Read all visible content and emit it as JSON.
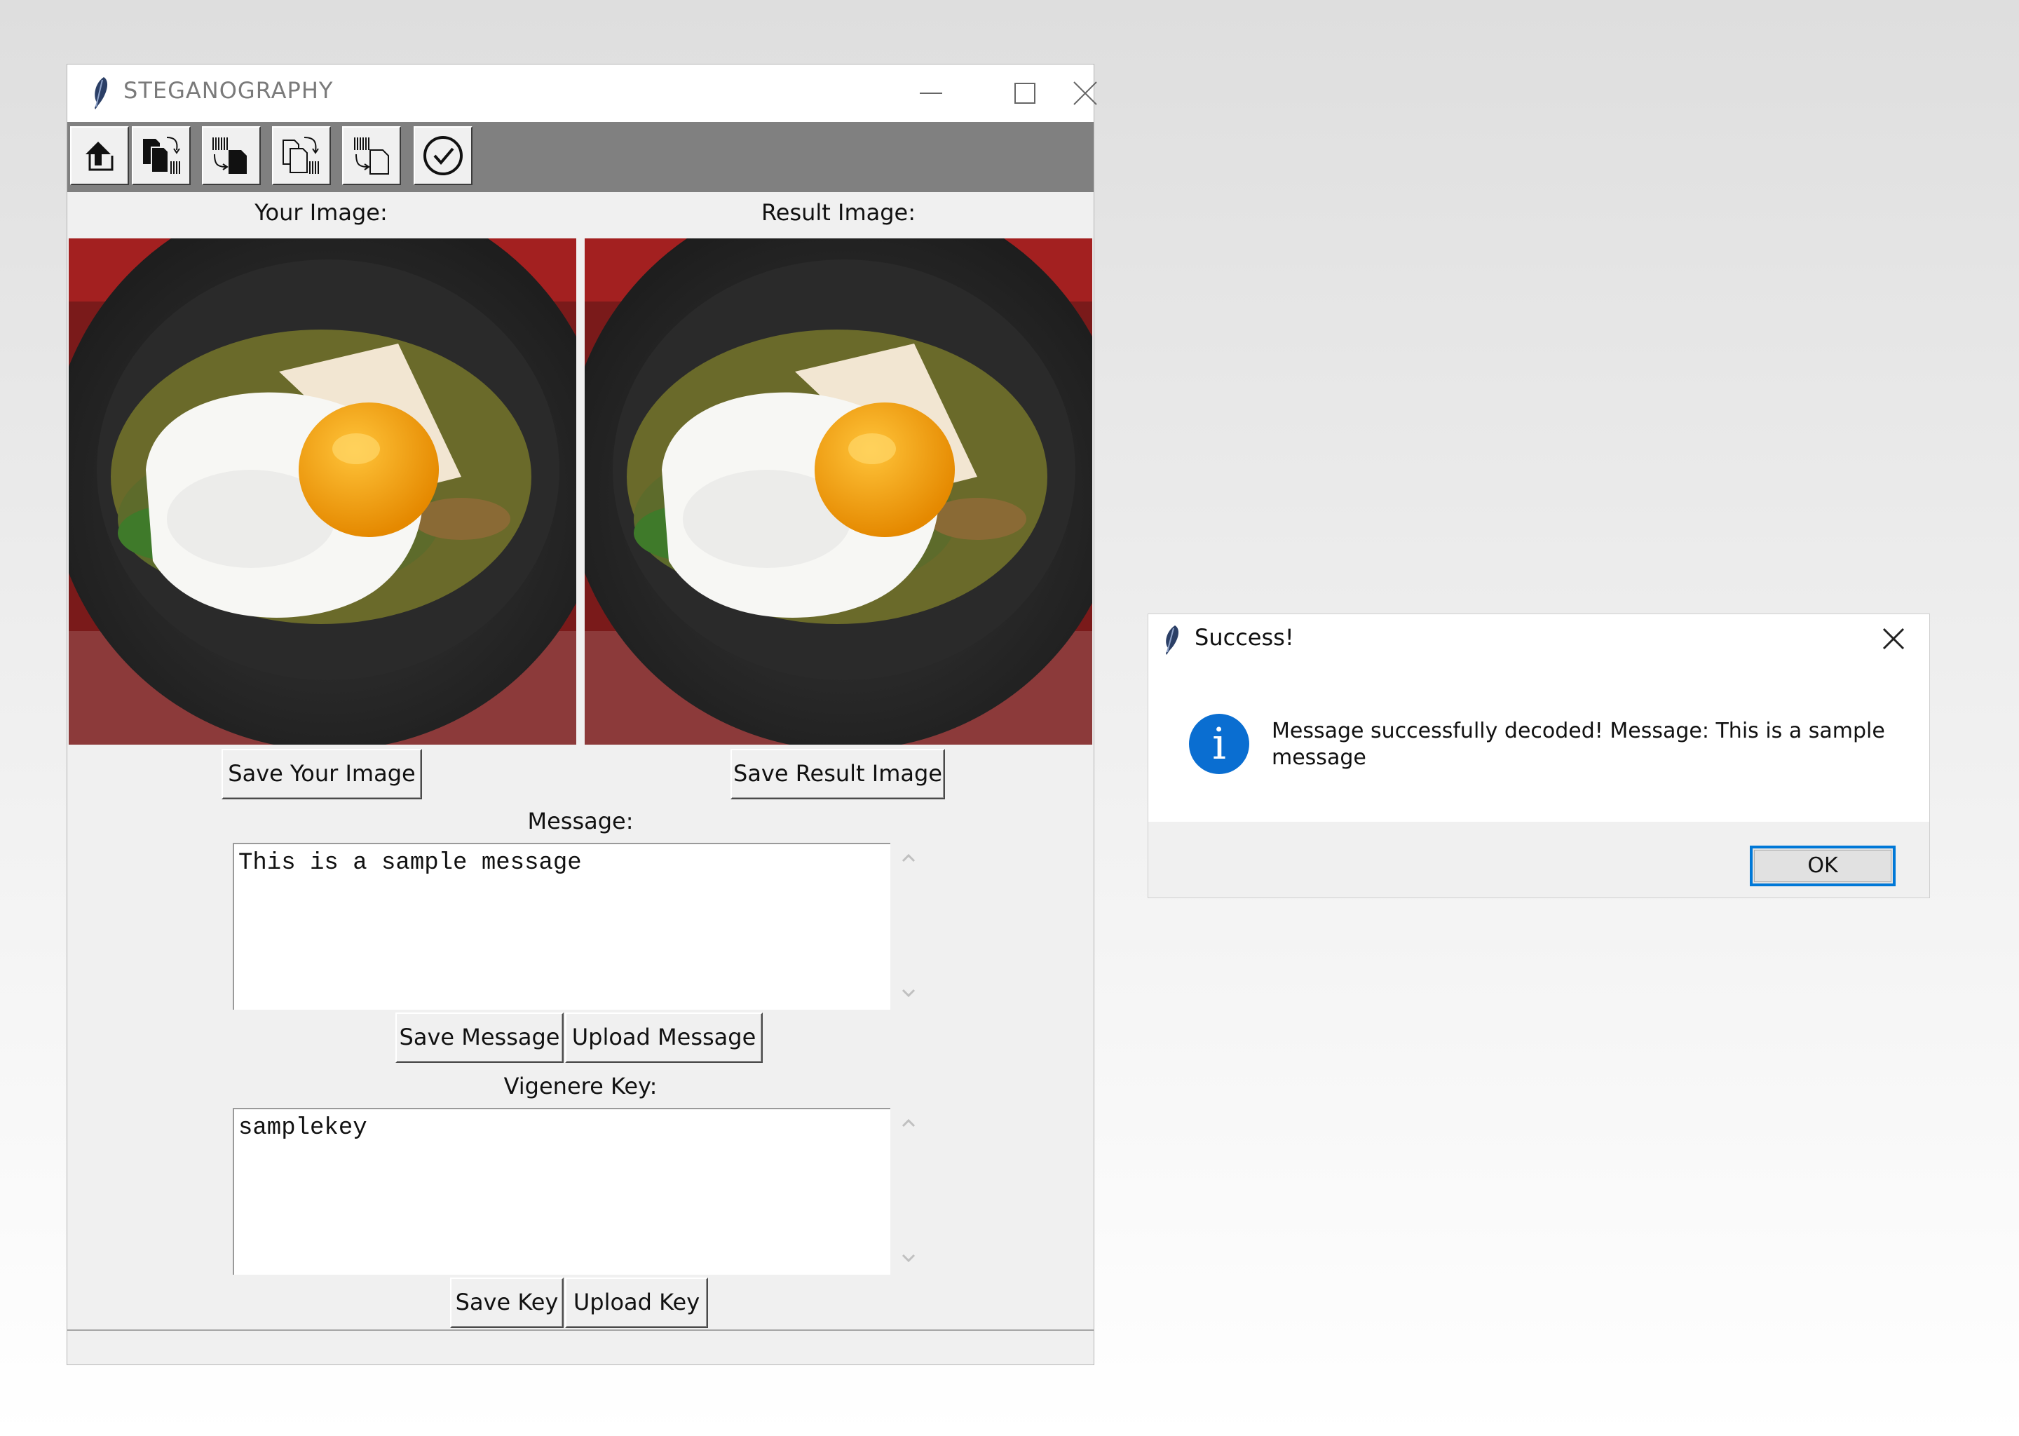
{
  "main_window": {
    "title": "STEGANOGRAPHY",
    "toolbar": [
      {
        "icon": "upload-icon"
      },
      {
        "icon": "encode-message-icon"
      },
      {
        "icon": "decode-message-icon"
      },
      {
        "icon": "encode-file-icon"
      },
      {
        "icon": "decode-file-icon"
      },
      {
        "icon": "check-circle-icon"
      }
    ],
    "your_image_label": "Your Image:",
    "result_image_label": "Result Image:",
    "save_your_image": "Save Your Image",
    "save_result_image": "Save Result Image",
    "message_label": "Message:",
    "message_text": "This is a sample message",
    "save_message": "Save Message",
    "upload_message": "Upload Message",
    "key_label": "Vigenere Key:",
    "key_text": "samplekey",
    "save_key": "Save Key",
    "upload_key": "Upload Key"
  },
  "dialog": {
    "title": "Success!",
    "message": "Message successfully decoded! Message: This is a sample message",
    "ok": "OK",
    "icon": "info-icon"
  },
  "colors": {
    "toolbar_bg": "#808080",
    "window_bg": "#f0f0f0",
    "info_blue": "#0a6ed1",
    "ok_focus": "#0078d7"
  }
}
